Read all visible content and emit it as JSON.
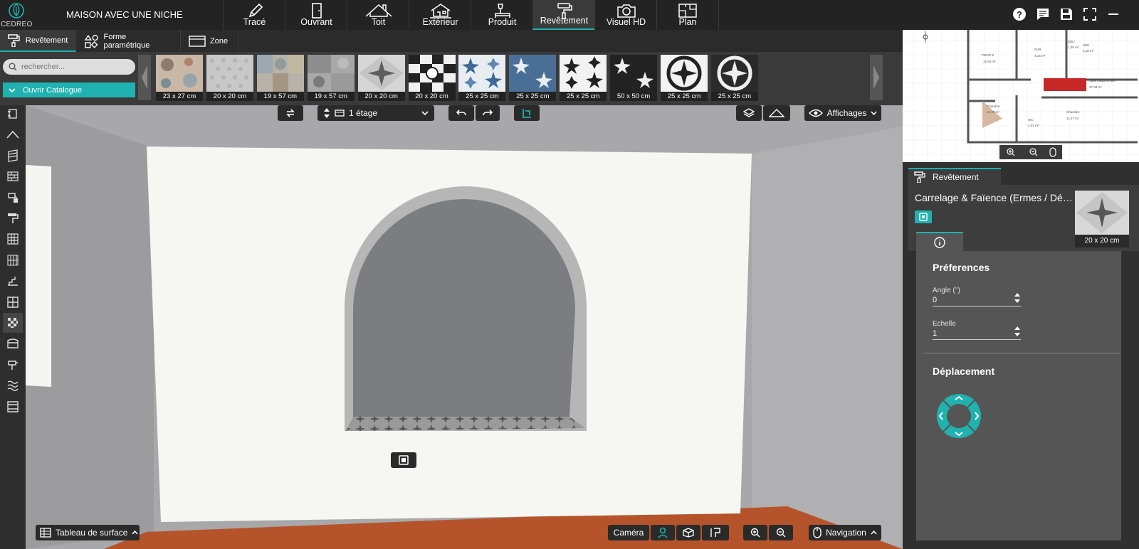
{
  "app": {
    "logo_text": "CEDREO",
    "project_title": "MAISON AVEC UNE NICHE"
  },
  "main_tabs": [
    {
      "label": "Tracé",
      "icon": "pencil-icon"
    },
    {
      "label": "Ouvrant",
      "icon": "door-icon"
    },
    {
      "label": "Toit",
      "icon": "roof-icon"
    },
    {
      "label": "Extérieur",
      "icon": "house-exterior-icon"
    },
    {
      "label": "Produit",
      "icon": "lamp-icon"
    },
    {
      "label": "Revêtement",
      "icon": "paint-roller-icon"
    },
    {
      "label": "Visuel HD",
      "icon": "camera-icon"
    },
    {
      "label": "Plan",
      "icon": "floor-plan-icon"
    }
  ],
  "active_tab": "Revêtement",
  "sub_tabs": [
    "Revêtement",
    "Forme paramétrique",
    "Zone"
  ],
  "catalog": {
    "search_placeholder": "rechercher...",
    "open_label": "Ouvrir Catalogue",
    "thumbs": [
      "23 x 27 cm",
      "20 x 20 cm",
      "19 x 57 cm",
      "19 x 57 cm",
      "20 x 20 cm",
      "20 x 20 cm",
      "25 x 25 cm",
      "25 x 25 cm",
      "25 x 25 cm",
      "50 x 50 cm",
      "25 x 25 cm",
      "25 x 25 cm"
    ]
  },
  "viewport": {
    "floor_label": "1 étage",
    "display_label": "Affichages",
    "surface_table_label": "Tableau de surface",
    "camera_label": "Caméra",
    "navigation_label": "Navigation"
  },
  "minimap": {
    "rooms": [
      "PIECE 0",
      "12,54 m²",
      "SUB",
      "4,16 m²",
      "SDU",
      "1,38 m²",
      "SDE",
      "3,18 m²",
      "Chambre",
      "14,49 m²",
      "WC",
      "2,01 m²",
      "Chambre",
      "11,47 m²",
      "Salle traditionnelle",
      "37,33 m²"
    ]
  },
  "panel": {
    "tab_label": "Revêtement",
    "material_title": "Carrelage & Faïence (Ermes / Dé…",
    "material_size": "20 x 20 cm",
    "preferences_title": "Préferences",
    "angle_label": "Angle (°)",
    "angle_value": "0",
    "scale_label": "Echelle",
    "scale_value": "1",
    "move_title": "Déplacement"
  },
  "colors": {
    "accent": "#1fb2b0",
    "wall": "#f6f7f2",
    "niche": "#7c7d81",
    "floor": "#b5542b"
  }
}
